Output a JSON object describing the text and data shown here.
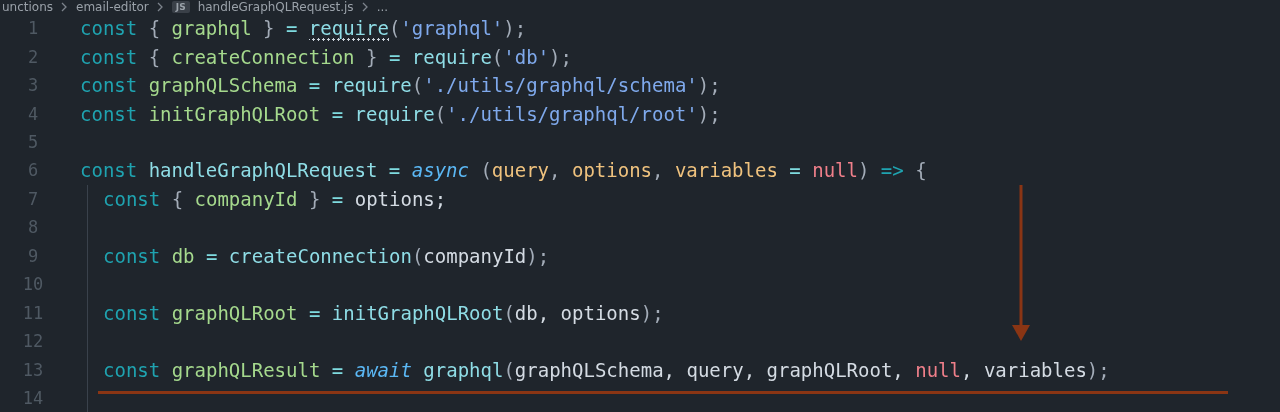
{
  "breadcrumb": [
    {
      "text": "unctions",
      "kind": "folder"
    },
    {
      "text": "email-editor",
      "kind": "folder"
    },
    {
      "text": "handleGraphQLRequest.js",
      "kind": "jsfile",
      "badge": "JS"
    },
    {
      "text": "...",
      "kind": "more"
    }
  ],
  "lines": [
    {
      "number": "1",
      "tokens": [
        {
          "text": "const",
          "kind": "keyword"
        },
        {
          "text": " { ",
          "kind": "punct"
        },
        {
          "text": "graphql",
          "kind": "var"
        },
        {
          "text": " } ",
          "kind": "punct"
        },
        {
          "text": "= ",
          "kind": "op"
        },
        {
          "text": "require",
          "kind": "func",
          "hint": true
        },
        {
          "text": "(",
          "kind": "punct"
        },
        {
          "text": "'graphql'",
          "kind": "string"
        },
        {
          "text": ");",
          "kind": "punct"
        }
      ]
    },
    {
      "number": "2",
      "tokens": [
        {
          "text": "const",
          "kind": "keyword"
        },
        {
          "text": " { ",
          "kind": "punct"
        },
        {
          "text": "createConnection",
          "kind": "var"
        },
        {
          "text": " } ",
          "kind": "punct"
        },
        {
          "text": "= ",
          "kind": "op"
        },
        {
          "text": "require",
          "kind": "func"
        },
        {
          "text": "(",
          "kind": "punct"
        },
        {
          "text": "'db'",
          "kind": "string"
        },
        {
          "text": ");",
          "kind": "punct"
        }
      ]
    },
    {
      "number": "3",
      "tokens": [
        {
          "text": "const ",
          "kind": "keyword"
        },
        {
          "text": "graphQLSchema",
          "kind": "var"
        },
        {
          "text": " = ",
          "kind": "op"
        },
        {
          "text": "require",
          "kind": "func"
        },
        {
          "text": "(",
          "kind": "punct"
        },
        {
          "text": "'./utils/graphql/schema'",
          "kind": "string"
        },
        {
          "text": ");",
          "kind": "punct"
        }
      ]
    },
    {
      "number": "4",
      "tokens": [
        {
          "text": "const ",
          "kind": "keyword"
        },
        {
          "text": "initGraphQLRoot",
          "kind": "var"
        },
        {
          "text": " = ",
          "kind": "op"
        },
        {
          "text": "require",
          "kind": "func"
        },
        {
          "text": "(",
          "kind": "punct"
        },
        {
          "text": "'./utils/graphql/root'",
          "kind": "string"
        },
        {
          "text": ");",
          "kind": "punct"
        }
      ]
    },
    {
      "number": "5"
    },
    {
      "number": "6",
      "tokens": [
        {
          "text": "const ",
          "kind": "keyword"
        },
        {
          "text": "handleGraphQLRequest",
          "kind": "func"
        },
        {
          "text": " = ",
          "kind": "op"
        },
        {
          "text": "async",
          "kind": "italic"
        },
        {
          "text": " (",
          "kind": "punct"
        },
        {
          "text": "query",
          "kind": "param"
        },
        {
          "text": ", ",
          "kind": "punct"
        },
        {
          "text": "options",
          "kind": "param"
        },
        {
          "text": ", ",
          "kind": "punct"
        },
        {
          "text": "variables",
          "kind": "param"
        },
        {
          "text": " = ",
          "kind": "op"
        },
        {
          "text": "null",
          "kind": "null"
        },
        {
          "text": ") ",
          "kind": "punct"
        },
        {
          "text": "=>",
          "kind": "keyword"
        },
        {
          "text": " {",
          "kind": "punct"
        }
      ],
      "children": [
        {
          "number": "7",
          "tokens": [
            {
              "text": "const",
              "kind": "keyword"
            },
            {
              "text": " { ",
              "kind": "punct"
            },
            {
              "text": "companyId",
              "kind": "var"
            },
            {
              "text": " } ",
              "kind": "punct"
            },
            {
              "text": "=",
              "kind": "op"
            },
            {
              "text": " options;",
              "kind": "plain"
            }
          ]
        },
        {
          "number": "8"
        },
        {
          "number": "9",
          "tokens": [
            {
              "text": "const ",
              "kind": "keyword"
            },
            {
              "text": "db",
              "kind": "var"
            },
            {
              "text": " = ",
              "kind": "op"
            },
            {
              "text": "createConnection",
              "kind": "func"
            },
            {
              "text": "(",
              "kind": "punct"
            },
            {
              "text": "companyId",
              "kind": "plain"
            },
            {
              "text": ");",
              "kind": "punct"
            }
          ]
        },
        {
          "number": "10"
        },
        {
          "number": "11",
          "tokens": [
            {
              "text": "const ",
              "kind": "keyword"
            },
            {
              "text": "graphQLRoot",
              "kind": "var"
            },
            {
              "text": " = ",
              "kind": "op"
            },
            {
              "text": "initGraphQLRoot",
              "kind": "func"
            },
            {
              "text": "(",
              "kind": "punct"
            },
            {
              "text": "db, options",
              "kind": "plain"
            },
            {
              "text": ");",
              "kind": "punct"
            }
          ]
        },
        {
          "number": "12"
        },
        {
          "number": "13",
          "tokens": [
            {
              "text": "const ",
              "kind": "keyword"
            },
            {
              "text": "graphQLResult",
              "kind": "var"
            },
            {
              "text": " = ",
              "kind": "op"
            },
            {
              "text": "await",
              "kind": "italic"
            },
            {
              "text": " graphql",
              "kind": "func"
            },
            {
              "text": "(",
              "kind": "punct"
            },
            {
              "text": "graphQLSchema, query, graphQLRoot, ",
              "kind": "plain"
            },
            {
              "text": "null",
              "kind": "null"
            },
            {
              "text": ", variables",
              "kind": "plain"
            },
            {
              "text": ");",
              "kind": "punct"
            }
          ]
        },
        {
          "number": "14"
        }
      ]
    }
  ]
}
